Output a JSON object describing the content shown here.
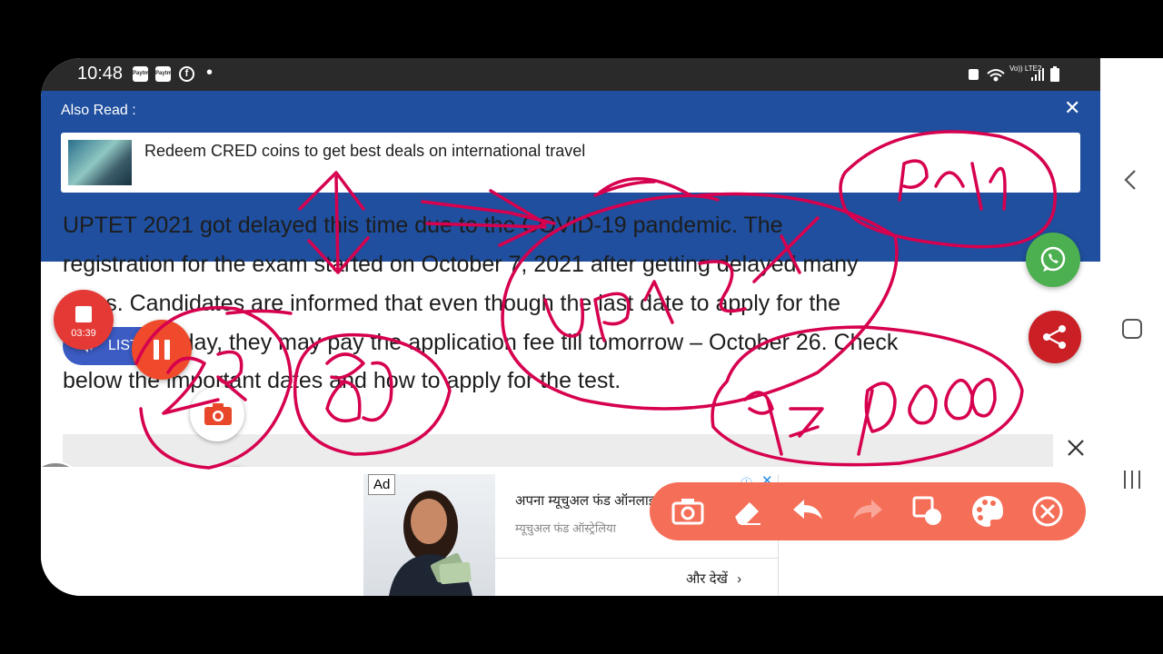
{
  "status_bar": {
    "time": "10:48",
    "notif_icons": [
      "paytm-icon",
      "paytm-icon",
      "facebook-icon"
    ],
    "notif_dot": "•",
    "network": "Vo)) LTE2"
  },
  "also_read": {
    "heading": "Also Read :",
    "close_glyph": "✕",
    "card_title": "Redeem CRED coins to get best deals on international travel"
  },
  "article": {
    "lines": [
      "UPTET 2021 got delayed this time due to the COVID-19 pandemic. The",
      "registration for the exam started on October 7, 2021 after getting delayed many",
      "times. Candidates are informed that even though the last date to apply for the",
      "registration day, they may pay the application fee till tomorrow – October 26. Check",
      "below the important dates and how to apply for the test."
    ]
  },
  "recorder": {
    "timer": "03:39",
    "listen_label": "LISTEN"
  },
  "ad": {
    "badge": "Ad",
    "title": "अपना म्यूचुअल फंड ऑनलाइन खोलें",
    "subtitle": "म्यूचुअल फंड ऑस्ट्रेलिया",
    "more_label": "और देखें",
    "close_glyph": "✕"
  },
  "toolbar": {
    "tools": [
      "camera-icon",
      "eraser-icon",
      "undo-icon",
      "redo-icon",
      "shapes-icon",
      "palette-icon",
      "close-icon"
    ]
  },
  "colors": {
    "header_blue": "#1f4f9e",
    "ink": "#d6004f",
    "toolbar": "#f56e58",
    "record_red": "#e53935",
    "whatsapp": "#4caf50"
  }
}
